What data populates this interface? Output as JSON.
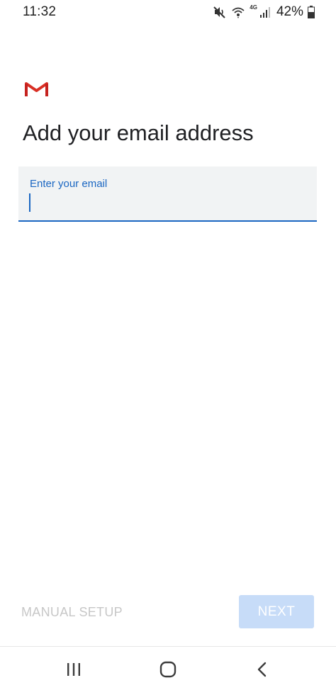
{
  "status_bar": {
    "time": "11:32",
    "network": "4G",
    "battery_percent": "42%",
    "icons": [
      "mute-icon",
      "wifi-icon",
      "signal-icon",
      "battery-icon"
    ]
  },
  "app": {
    "logo": "gmail-logo",
    "title": "Add your email address"
  },
  "email_field": {
    "label": "Enter your email",
    "value": "",
    "accent_color": "#1a66c2"
  },
  "actions": {
    "manual_setup_label": "MANUAL SETUP",
    "next_label": "NEXT",
    "next_bg_color": "#c7dcf8"
  },
  "nav_bar": {
    "buttons": [
      "recent-apps-icon",
      "home-icon",
      "back-icon"
    ]
  }
}
